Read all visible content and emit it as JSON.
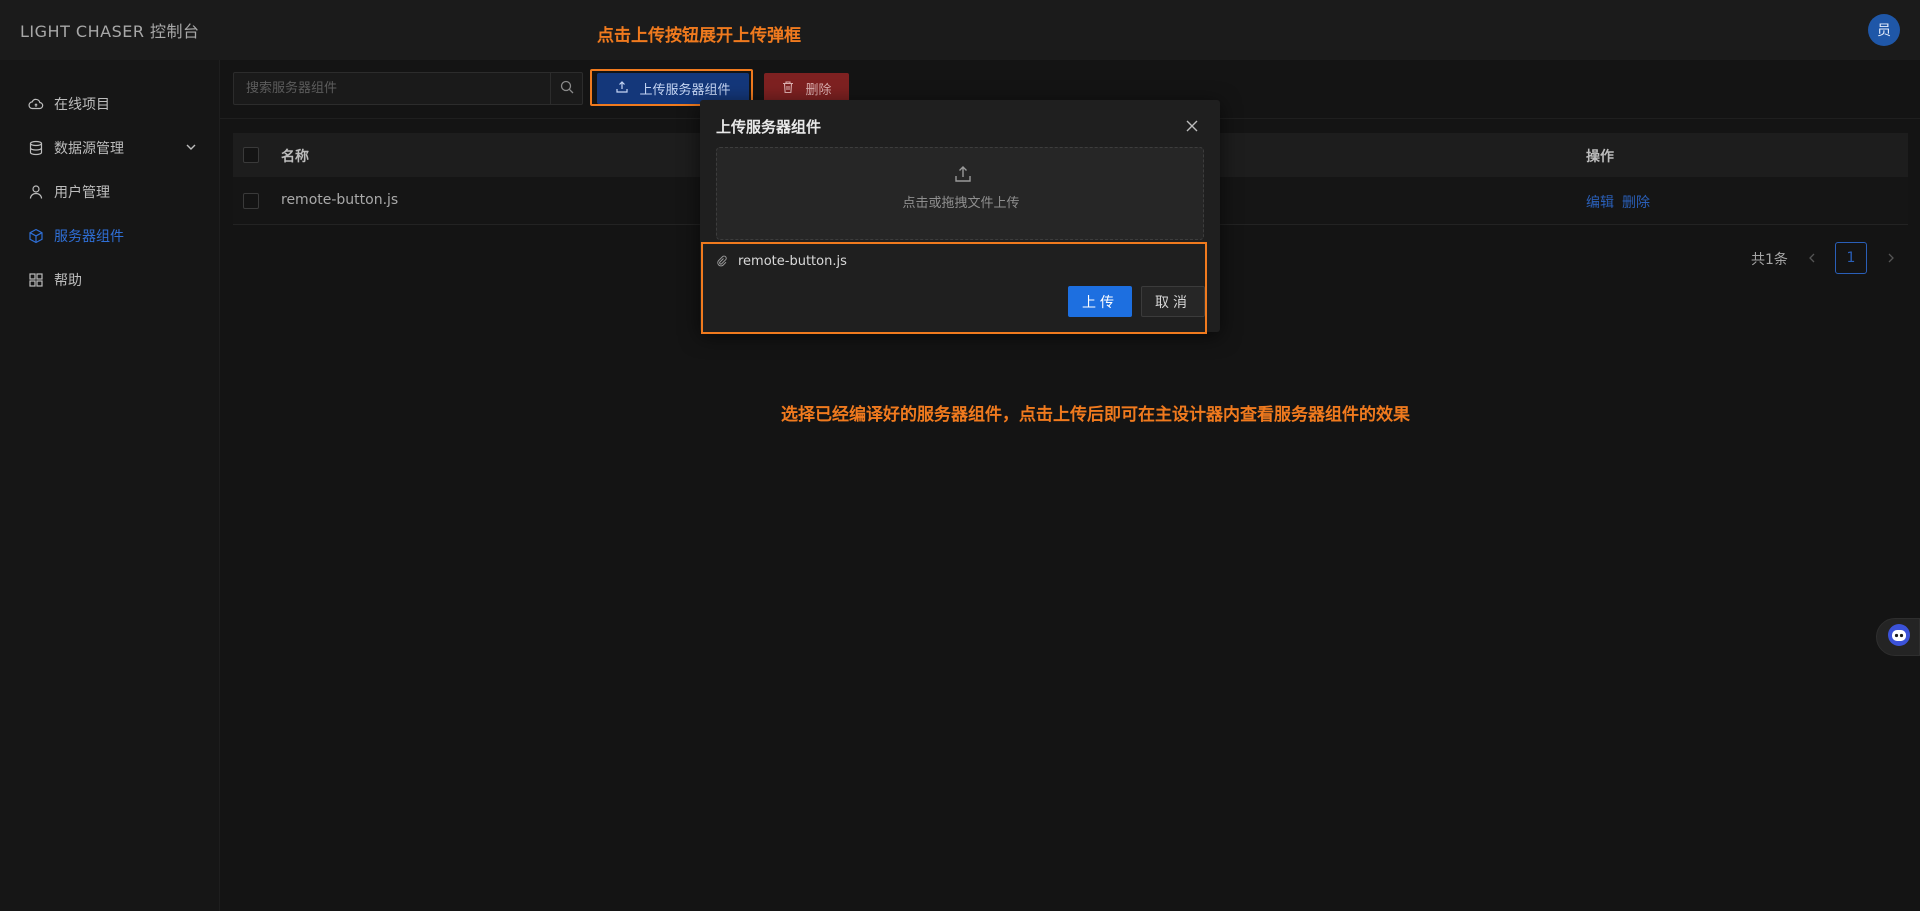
{
  "header": {
    "brand": "LIGHT CHASER 控制台",
    "avatar_text": "员"
  },
  "sidebar": {
    "items": [
      {
        "label": "在线项目",
        "icon": "cloud-icon"
      },
      {
        "label": "数据源管理",
        "icon": "database-icon",
        "has_submenu": true
      },
      {
        "label": "用户管理",
        "icon": "user-icon"
      },
      {
        "label": "服务器组件",
        "icon": "cube-icon",
        "active": true
      },
      {
        "label": "帮助",
        "icon": "apps-icon"
      }
    ]
  },
  "toolbar": {
    "search_placeholder": "搜索服务器组件",
    "upload_label": "上传服务器组件",
    "delete_label": "删除"
  },
  "table": {
    "columns": [
      "名称",
      "操作"
    ],
    "rows": [
      {
        "name": "remote-button.js",
        "actions": [
          "编辑",
          "删除"
        ]
      }
    ]
  },
  "pagination": {
    "total_text": "共1条",
    "current_page": "1"
  },
  "annotations": {
    "top": "点击上传按钮展开上传弹框",
    "middle": "选择已经编译好的服务器组件，点击上传后即可在主设计器内查看服务器组件的效果"
  },
  "modal": {
    "title": "上传服务器组件",
    "dropzone_text": "点击或拖拽文件上传",
    "file_name": "remote-button.js",
    "ok_label": "上传",
    "cancel_label": "取消"
  },
  "colors": {
    "accent": "#1d6fe0",
    "annotation": "#f07a1e",
    "danger": "#7e2121"
  }
}
